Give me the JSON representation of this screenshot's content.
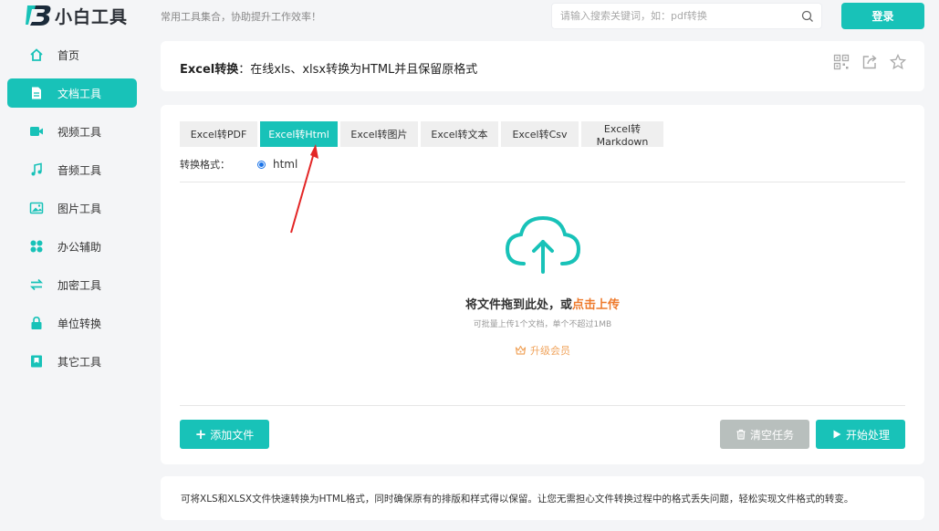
{
  "brand": {
    "name": "小白工具",
    "slogan": "常用工具集合，协助提升工作效率！",
    "accent": "#18c2b8"
  },
  "search": {
    "placeholder": "请输入搜索关键词，如：pdf转换"
  },
  "header": {
    "login_label": "登录"
  },
  "sidebar": {
    "items": [
      {
        "label": "首页",
        "icon": "home-icon"
      },
      {
        "label": "文档工具",
        "icon": "document-icon",
        "active": true
      },
      {
        "label": "视频工具",
        "icon": "video-icon"
      },
      {
        "label": "音频工具",
        "icon": "music-icon"
      },
      {
        "label": "图片工具",
        "icon": "image-icon"
      },
      {
        "label": "办公辅助",
        "icon": "grid-icon"
      },
      {
        "label": "加密工具",
        "icon": "swap-icon"
      },
      {
        "label": "单位转换",
        "icon": "lock-icon"
      },
      {
        "label": "其它工具",
        "icon": "bookmark-icon"
      }
    ]
  },
  "page": {
    "title_strong": "Excel转换",
    "title_rest": "：在线xls、xlsx转换为HTML并且保留原格式"
  },
  "tabs": [
    {
      "label": "Excel转PDF"
    },
    {
      "label": "Excel转Html",
      "active": true
    },
    {
      "label": "Excel转图片"
    },
    {
      "label": "Excel转文本"
    },
    {
      "label": "Excel转Csv"
    },
    {
      "label": "Excel转Markdown"
    }
  ],
  "format": {
    "label": "转换格式：",
    "value": "html"
  },
  "upload": {
    "drop_prefix": "将文件拖到此处，或",
    "drop_link": "点击上传",
    "hint": "可批量上传1个文档，单个不超过1MB",
    "upgrade_label": "升级会员"
  },
  "actions": {
    "add_label": "添加文件",
    "clear_label": "清空任务",
    "start_label": "开始处理"
  },
  "description": "可将XLS和XLSX文件快速转换为HTML格式，同时确保原有的排版和样式得以保留。让您无需担心文件转换过程中的格式丢失问题，轻松实现文件格式的转变。"
}
